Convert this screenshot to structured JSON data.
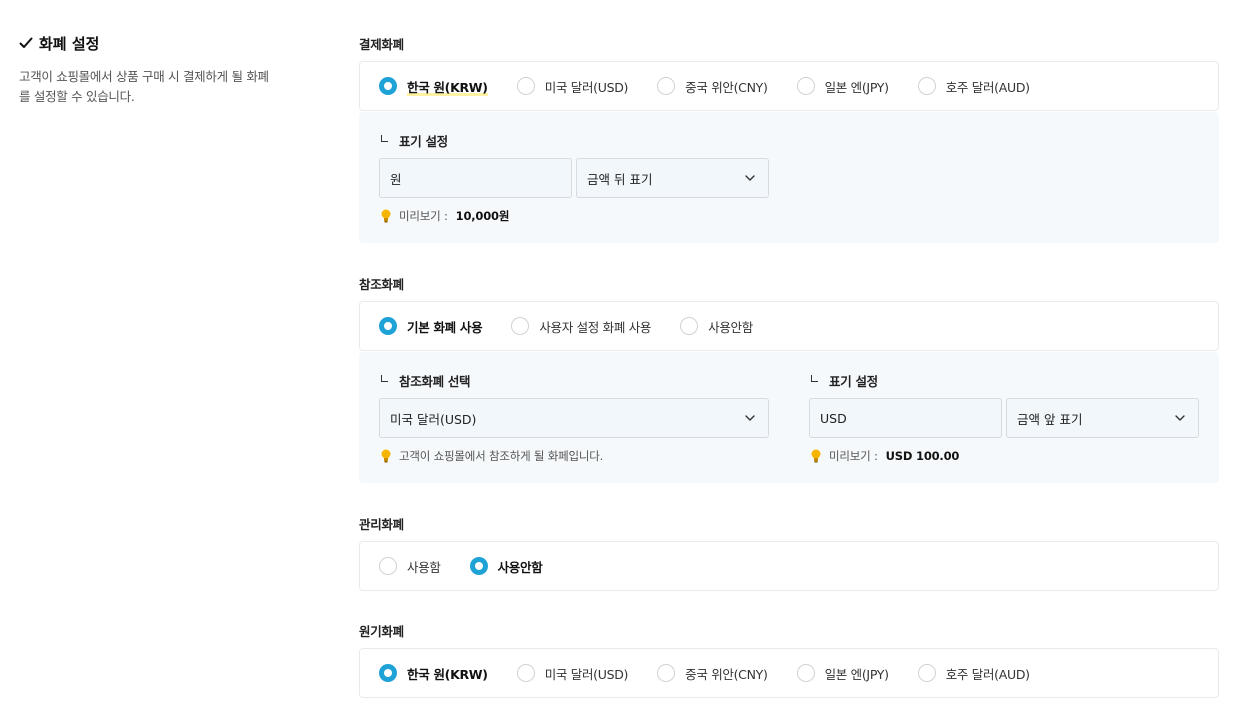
{
  "sidebar": {
    "title": "화폐 설정",
    "description": "고객이 쇼핑몰에서 상품 구매 시 결제하게 될 화폐를 설정할 수 있습니다."
  },
  "payment_currency": {
    "label": "결제화폐",
    "options": [
      "한국 원(KRW)",
      "미국 달러(USD)",
      "중국 위안(CNY)",
      "일본 엔(JPY)",
      "호주 달러(AUD)"
    ],
    "selected": "한국 원(KRW)",
    "display": {
      "title": "표기 설정",
      "symbol_value": "원",
      "position_value": "금액 뒤 표기",
      "preview_label": "미리보기 :",
      "preview_value": "10,000원"
    }
  },
  "reference_currency": {
    "label": "참조화폐",
    "options": [
      "기본 화폐 사용",
      "사용자 설정 화폐 사용",
      "사용안함"
    ],
    "selected": "기본 화폐 사용",
    "select_title": "참조화폐 선택",
    "select_value": "미국 달러(USD)",
    "select_hint": "고객이 쇼핑몰에서 참조하게 될 화페입니다.",
    "display": {
      "title": "표기 설정",
      "symbol_value": "USD",
      "position_value": "금액 앞 표기",
      "preview_label": "미리보기 :",
      "preview_value": "USD 100.00"
    }
  },
  "management_currency": {
    "label": "관리화폐",
    "options": [
      "사용함",
      "사용안함"
    ],
    "selected": "사용안함"
  },
  "base_currency": {
    "label": "원기화폐",
    "options": [
      "한국 원(KRW)",
      "미국 달러(USD)",
      "중국 위안(CNY)",
      "일본 엔(JPY)",
      "호주 달러(AUD)"
    ],
    "selected": "한국 원(KRW)"
  },
  "colors": {
    "accent": "#1fa3d6",
    "panel": "#f6f9fb",
    "field": "#f1f7fb"
  },
  "icons": {
    "check": "check-icon",
    "bulb": "lightbulb-icon",
    "chevron": "chevron-down-icon",
    "corner": "corner-arrow-icon"
  }
}
